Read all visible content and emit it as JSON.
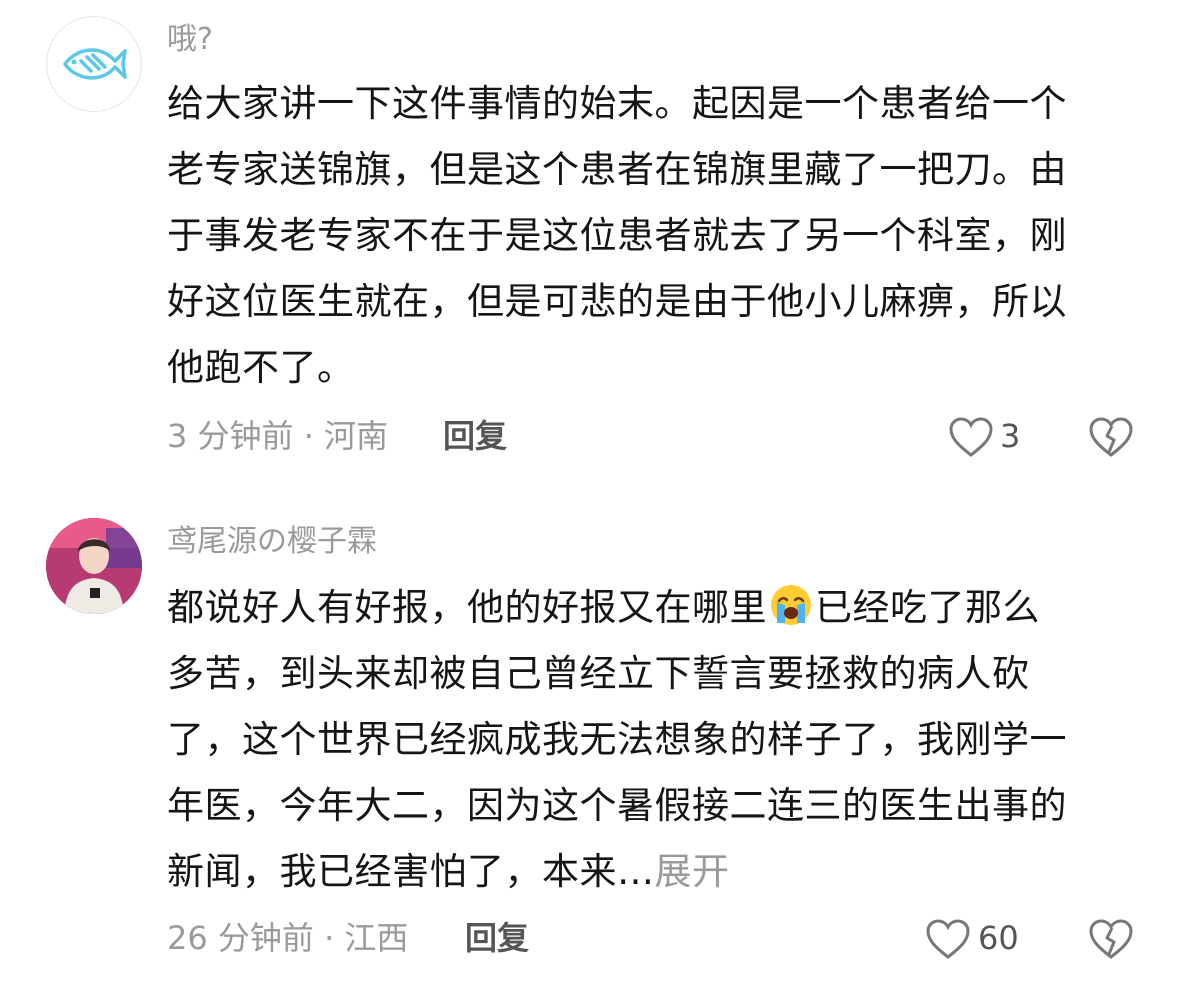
{
  "comments": [
    {
      "username": "哦?",
      "avatar_icon": "fish-icon",
      "lines": [
        "给大家讲一下这件事情的始末。起因是一个患者给一个",
        "老专家送锦旗，但是这个患者在锦旗里藏了一把刀。由",
        "于事发老专家不在于是这位患者就去了另一个科室，刚",
        "好这位医生就在，但是可悲的是由于他小儿麻痹，所以",
        "他跑不了。"
      ],
      "meta": "3 分钟前 · 河南",
      "reply_label": "回复",
      "like_count": "3"
    },
    {
      "username": "鸢尾源の樱子霖",
      "avatar_icon": "person-photo-avatar",
      "lines": [
        {
          "before": "都说好人有好报，他的好报又在哪里",
          "emoji": "crying-face-emoji",
          "after": "已经吃了那么"
        },
        "多苦，到头来却被自己曾经立下誓言要拯救的病人砍",
        "了，这个世界已经疯成我无法想象的样子了，我刚学一",
        "年医，今年大二，因为这个暑假接二连三的医生出事的",
        {
          "before": "新闻，我已经害怕了，本来…",
          "expand": "展开"
        }
      ],
      "meta": "26 分钟前 · 江西",
      "reply_label": "回复",
      "like_count": "60"
    }
  ],
  "colors": {
    "meta_gray": "#9a9a9a",
    "text": "#151515",
    "fish_blue": "#5bc8e8"
  }
}
